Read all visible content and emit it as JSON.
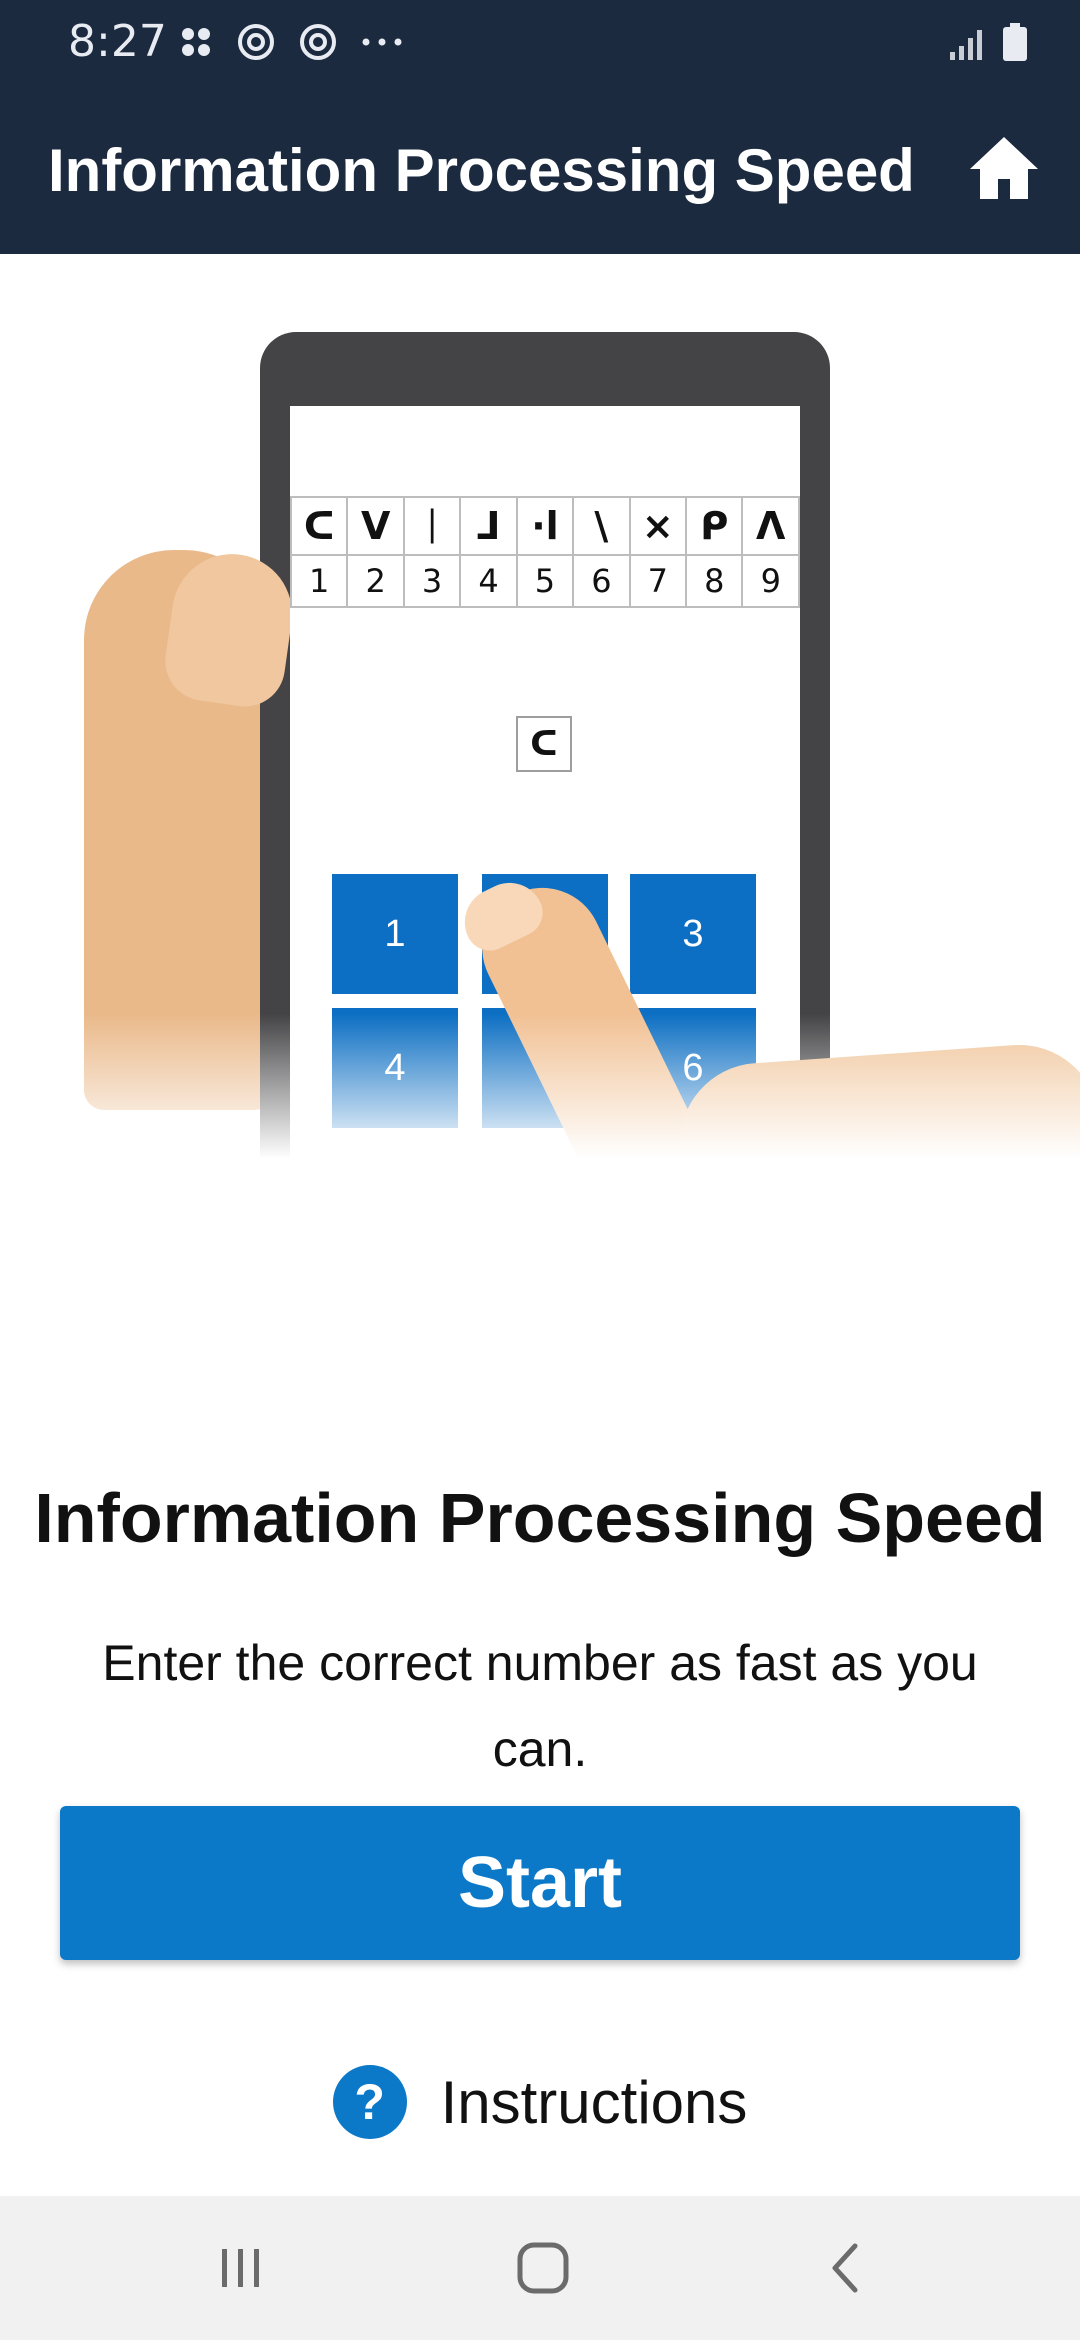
{
  "status_bar": {
    "time": "8:27",
    "notification_icons": [
      "apps-icon",
      "sync-icon",
      "sync-icon",
      "more-icon"
    ],
    "right_icons": [
      "signal-icon",
      "battery-icon"
    ]
  },
  "app_bar": {
    "title": "Information Processing Speed",
    "home_icon": "home-icon"
  },
  "illustration": {
    "symbols": [
      "ᑕ",
      "V",
      "ᛁ",
      "ᒧ",
      "·l",
      "\\",
      "×",
      "ᑭ",
      "Λ"
    ],
    "numbers": [
      "1",
      "2",
      "3",
      "4",
      "5",
      "6",
      "7",
      "8",
      "9"
    ],
    "target_symbol": "ᑕ",
    "keypad": [
      "1",
      "2",
      "3",
      "4",
      "5",
      "6"
    ]
  },
  "content": {
    "heading": "Information Processing Speed",
    "description": "Enter the correct number as fast as you can.",
    "start_label": "Start",
    "instructions_label": "Instructions",
    "help_icon": "?"
  },
  "nav_bar": {
    "icons": [
      "recent-apps-icon",
      "home-circle-icon",
      "back-icon"
    ]
  },
  "colors": {
    "app_bar_bg": "#1c2a40",
    "primary": "#0b78c8",
    "nav_bg": "#f1f1f1"
  }
}
